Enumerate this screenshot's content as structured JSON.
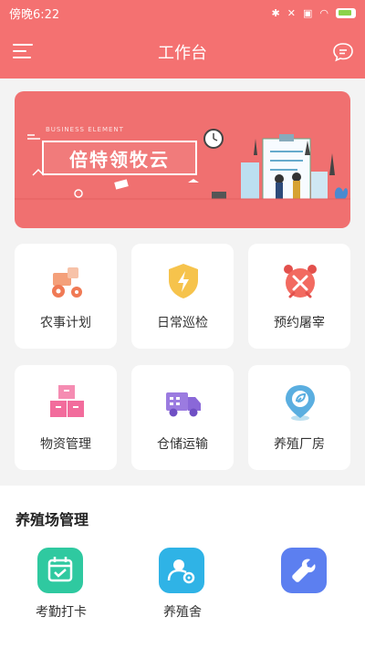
{
  "status_bar": {
    "time": "傍晚6:22"
  },
  "app_bar": {
    "title": "工作台"
  },
  "banner": {
    "title": "倍特领牧云",
    "tiny": "BUSINESS ELEMENT"
  },
  "grid": [
    {
      "label": "农事计划",
      "icon": "tractor-icon"
    },
    {
      "label": "日常巡检",
      "icon": "shield-icon"
    },
    {
      "label": "预约屠宰",
      "icon": "alarm-icon"
    },
    {
      "label": "物资管理",
      "icon": "boxes-icon"
    },
    {
      "label": "仓储运输",
      "icon": "truck-icon"
    },
    {
      "label": "养殖厂房",
      "icon": "location-icon"
    }
  ],
  "farm_section": {
    "title": "养殖场管理",
    "items": [
      {
        "label": "考勤打卡",
        "icon": "calendar-check-icon"
      },
      {
        "label": "养殖舍",
        "icon": "user-settings-icon"
      },
      {
        "label": "",
        "icon": "wrench-icon"
      }
    ]
  },
  "colors": {
    "primary": "#f47171",
    "background": "#f3f3f3"
  }
}
